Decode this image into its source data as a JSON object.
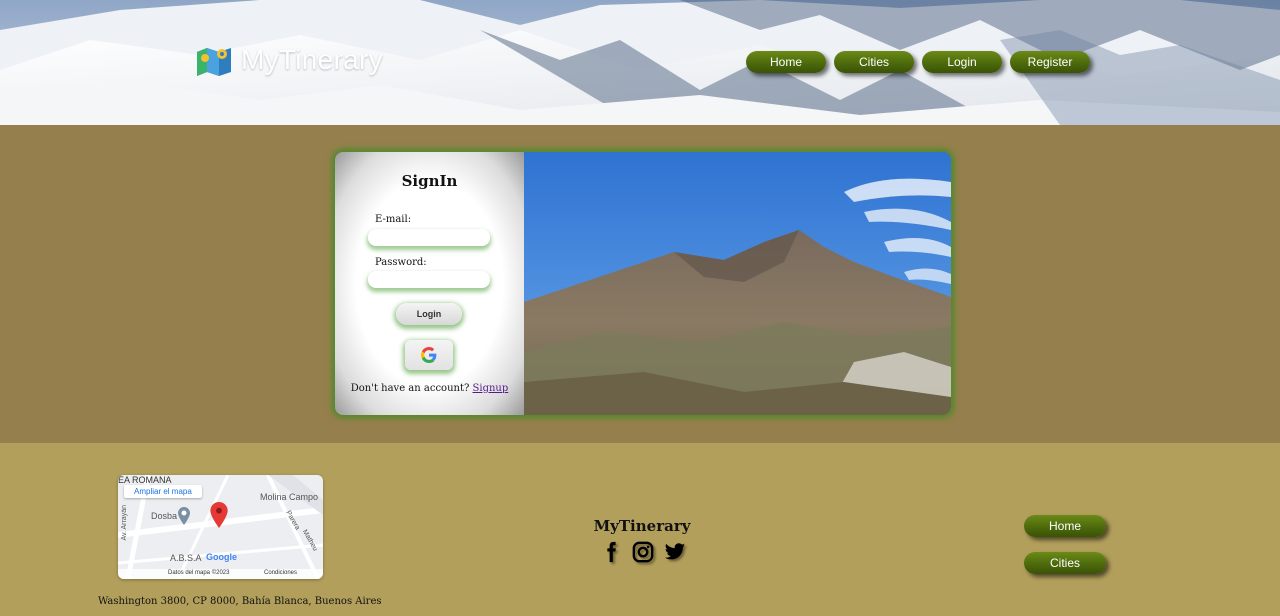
{
  "header": {
    "brand": "MyTinerary",
    "nav": [
      {
        "label": "Home"
      },
      {
        "label": "Cities"
      },
      {
        "label": "Login"
      },
      {
        "label": "Register"
      }
    ]
  },
  "signin": {
    "title": "SignIn",
    "email_label": "E-mail:",
    "email_value": "",
    "password_label": "Password:",
    "password_value": "",
    "login_label": "Login",
    "google_icon": "google-g-icon",
    "no_account_text": "Don't have an account? ",
    "signup_label": "Signup"
  },
  "footer": {
    "map": {
      "enlarge_label": "Ampliar el mapa",
      "place_top": "EA ROMANA",
      "place_right": "Molina Campo",
      "place_left": "Dosba",
      "place_bottom": "A.B.S.A",
      "street_left": "Av. Arrayán",
      "street_1": "Parera",
      "street_2": "Matheu",
      "attribution": "Datos del mapa ©2023",
      "terms": "Condiciones",
      "google": "Google"
    },
    "address": "Washington 3800, CP 8000, Bahía Blanca, Buenos Aires",
    "brand": "MyTinerary",
    "socials": [
      "facebook-icon",
      "instagram-icon",
      "twitter-icon"
    ],
    "nav": [
      {
        "label": "Home"
      },
      {
        "label": "Cities"
      }
    ]
  }
}
